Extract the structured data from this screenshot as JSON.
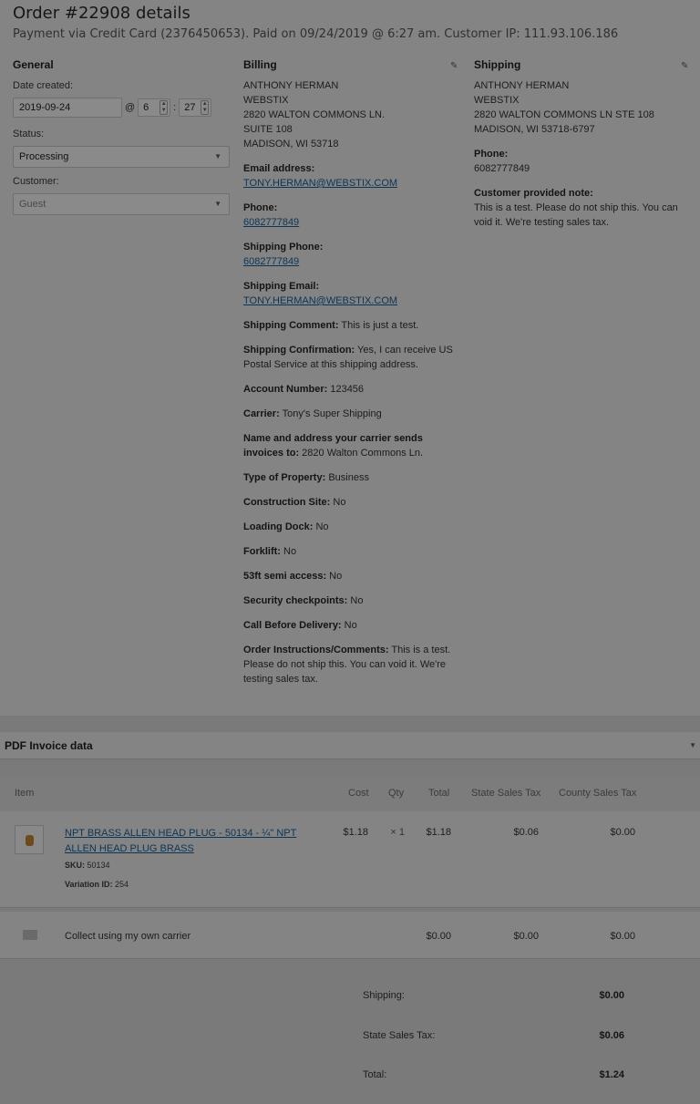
{
  "header": {
    "title": "Order #22908 details",
    "subtitle": "Payment via Credit Card (2376450653). Paid on 09/24/2019 @ 6:27 am. Customer IP: 111.93.106.186"
  },
  "general": {
    "heading": "General",
    "date_label": "Date created:",
    "date_value": "2019-09-24",
    "at": "@",
    "hour_value": "6",
    "minute_value": "27",
    "status_label": "Status:",
    "status_value": "Processing",
    "customer_label": "Customer:",
    "customer_value": "Guest"
  },
  "billing": {
    "heading": "Billing",
    "address": [
      "ANTHONY HERMAN",
      "WEBSTIX",
      "2820 WALTON COMMONS LN.",
      "SUITE 108",
      "MADISON, WI 53718"
    ],
    "email_label": "Email address:",
    "email": "TONY.HERMAN@WEBSTIX.COM",
    "phone_label": "Phone:",
    "phone": "6082777849",
    "ship_phone_label": "Shipping Phone:",
    "ship_phone": "6082777849",
    "ship_email_label": "Shipping Email:",
    "ship_email": "TONY.HERMAN@WEBSTIX.COM",
    "fields": [
      {
        "label": "Shipping Comment:",
        "value": " This is just a test."
      },
      {
        "label": "Shipping Confirmation:",
        "value": " Yes, I can receive US Postal Service at this shipping address."
      },
      {
        "label": "Account Number:",
        "value": " 123456"
      },
      {
        "label": "Carrier:",
        "value": " Tony's Super Shipping"
      },
      {
        "label": "Name and address your carrier sends invoices to:",
        "value": " 2820 Walton Commons Ln."
      },
      {
        "label": "Type of Property:",
        "value": " Business"
      },
      {
        "label": "Construction Site:",
        "value": " No"
      },
      {
        "label": "Loading Dock:",
        "value": " No"
      },
      {
        "label": "Forklift:",
        "value": " No"
      },
      {
        "label": "53ft semi access:",
        "value": " No"
      },
      {
        "label": "Security checkpoints:",
        "value": " No"
      },
      {
        "label": "Call Before Delivery:",
        "value": " No"
      },
      {
        "label": "Order Instructions/Comments:",
        "value": " This is a test. Please do not ship this. You can void it. We're testing sales tax."
      }
    ]
  },
  "shipping": {
    "heading": "Shipping",
    "address": [
      "ANTHONY HERMAN",
      "WEBSTIX",
      "2820 WALTON COMMONS LN STE 108",
      "MADISON, WI 53718-6797"
    ],
    "phone_label": "Phone:",
    "phone": "6082777849",
    "note_label": "Customer provided note:",
    "note": "This is a test. Please do not ship this. You can void it. We're testing sales tax."
  },
  "pdf_invoice": {
    "title": "PDF Invoice data"
  },
  "items_table": {
    "headers": {
      "item": "Item",
      "cost": "Cost",
      "qty": "Qty",
      "total": "Total",
      "state_tax": "State Sales Tax",
      "county_tax": "County Sales Tax"
    },
    "product": {
      "name": "NPT BRASS ALLEN HEAD PLUG - 50134 - ¼\" NPT ALLEN HEAD PLUG BRASS",
      "sku_label": "SKU:",
      "sku": " 50134",
      "variation_label": "Variation ID:",
      "variation": " 254",
      "cost": "$1.18",
      "qty": "× 1",
      "total": "$1.18",
      "state_tax": "$0.06",
      "county_tax": "$0.00"
    },
    "shipping_line": {
      "name": "Collect using my own carrier",
      "total": "$0.00",
      "state_tax": "$0.00",
      "county_tax": "$0.00"
    }
  },
  "totals": {
    "shipping_label": "Shipping:",
    "shipping": "$0.00",
    "state_tax_label": "State Sales Tax:",
    "state_tax": "$0.06",
    "total_label": "Total:",
    "total": "$1.24"
  },
  "icons": {
    "edit": "pencil-icon",
    "dropdown": "chevron-down-icon",
    "collapse": "caret-down-icon",
    "shipping": "truck-icon"
  }
}
